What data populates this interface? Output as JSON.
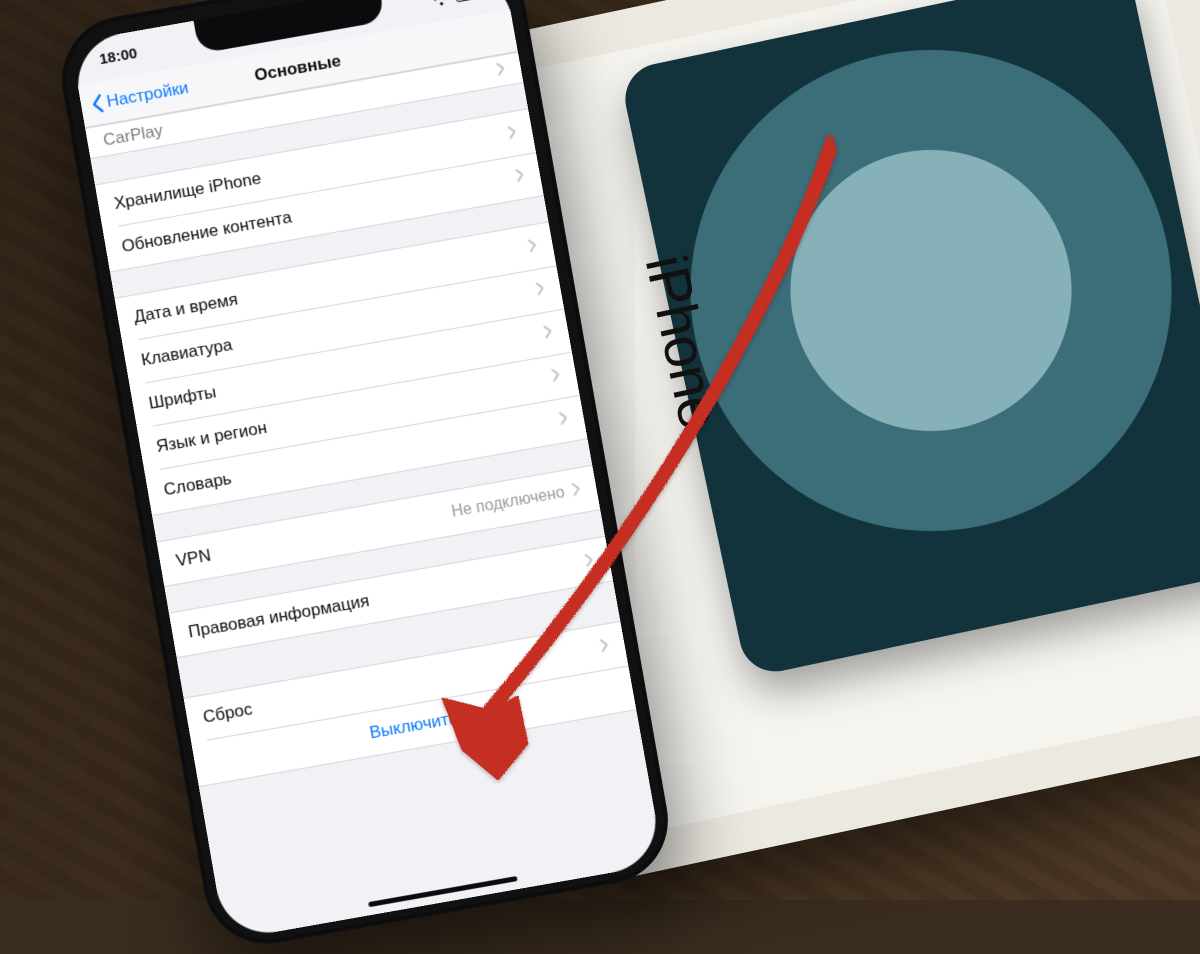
{
  "box": {
    "brand": "iPhone"
  },
  "statusbar": {
    "time": "18:00"
  },
  "navbar": {
    "back_label": "Настройки",
    "title": "Основные"
  },
  "groups": {
    "g0": {
      "carplay": "CarPlay"
    },
    "g1": {
      "storage": "Хранилище iPhone",
      "background_refresh": "Обновление контента"
    },
    "g2": {
      "datetime": "Дата и время",
      "keyboard": "Клавиатура",
      "fonts": "Шрифты",
      "language_region": "Язык и регион",
      "dictionary": "Словарь"
    },
    "g3": {
      "vpn": "VPN",
      "vpn_detail": "Не подключено"
    },
    "g4": {
      "legal": "Правовая информация"
    },
    "g5": {
      "reset": "Сброс",
      "shutdown": "Выключить"
    }
  },
  "colors": {
    "ios_blue": "#0a7aff",
    "arrow": "#c52f23"
  }
}
